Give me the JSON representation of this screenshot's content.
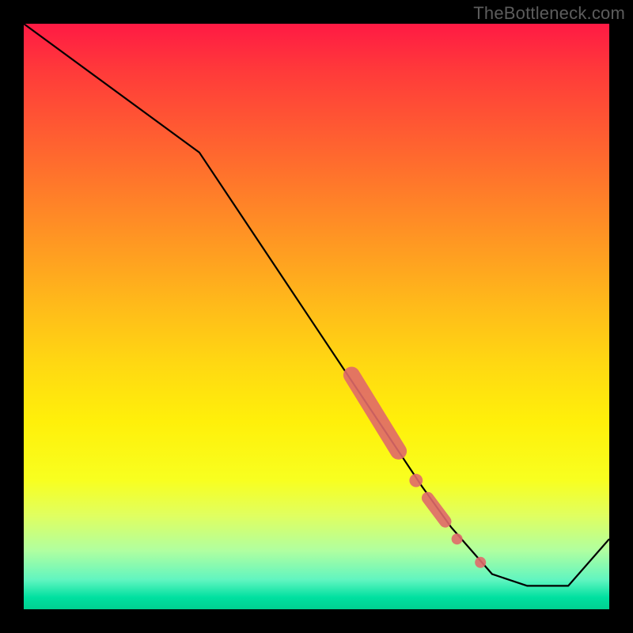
{
  "watermark": "TheBottleneck.com",
  "chart_data": {
    "type": "line",
    "title": "",
    "xlabel": "",
    "ylabel": "",
    "xlim": [
      0,
      100
    ],
    "ylim": [
      0,
      100
    ],
    "grid": false,
    "series": [
      {
        "name": "curve",
        "x": [
          0,
          30,
          62,
          68,
          73,
          80,
          86,
          93,
          100
        ],
        "y": [
          100,
          78,
          30,
          21,
          14,
          6,
          4,
          4,
          12
        ]
      }
    ],
    "markers": [
      {
        "shape": "thick-segment",
        "x0": 56,
        "y0": 40,
        "x1": 64,
        "y1": 27,
        "width": 3.0
      },
      {
        "shape": "dot",
        "x": 67,
        "y": 22,
        "r": 1.2
      },
      {
        "shape": "thick-segment",
        "x0": 69,
        "y0": 19,
        "x1": 72,
        "y1": 15,
        "width": 2.2
      },
      {
        "shape": "dot",
        "x": 74,
        "y": 12,
        "r": 1.0
      },
      {
        "shape": "dot",
        "x": 78,
        "y": 8,
        "r": 1.0
      }
    ],
    "marker_color": "#e06a6a",
    "curve_color": "#000000",
    "gradient_stops": [
      {
        "pos": 0.0,
        "color": "#ff1a44"
      },
      {
        "pos": 0.5,
        "color": "#ffd812"
      },
      {
        "pos": 0.85,
        "color": "#e0ff60"
      },
      {
        "pos": 1.0,
        "color": "#00d090"
      }
    ]
  }
}
